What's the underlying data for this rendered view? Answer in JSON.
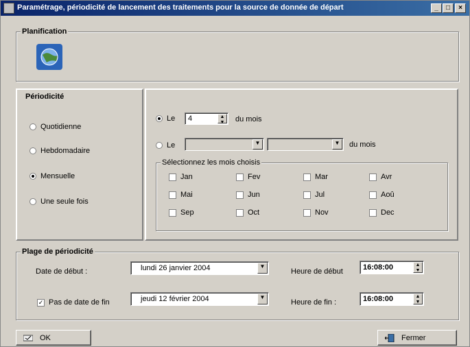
{
  "window": {
    "title": "Paramétrage, périodicité de lancement des traitements pour la source de donnée de départ",
    "minimize_label": "_",
    "maximize_label": "□",
    "close_label": "×"
  },
  "planification": {
    "legend": "Planification"
  },
  "periodicite": {
    "legend": "Périodicité",
    "options": [
      {
        "label": "Quotidienne",
        "checked": false
      },
      {
        "label": "Hebdomadaire",
        "checked": false
      },
      {
        "label": "Mensuelle",
        "checked": true
      },
      {
        "label": "Une seule fois",
        "checked": false
      }
    ]
  },
  "mensuel": {
    "le_label": "Le",
    "day_value": "4",
    "du_mois_label": "du mois",
    "le2_label": "Le",
    "du_mois2_label": "du mois",
    "months_legend": "Sélectionnez les mois choisis",
    "months": [
      "Jan",
      "Fev",
      "Mar",
      "Avr",
      "Mai",
      "Jun",
      "Jul",
      "Aoû",
      "Sep",
      "Oct",
      "Nov",
      "Dec"
    ]
  },
  "plage": {
    "legend": "Plage de périodicité",
    "date_debut_label": "Date de début :",
    "date_debut_value": "lundi   26   janvier   2004",
    "pas_date_fin_label": "Pas de date de fin",
    "pas_date_fin_checked": true,
    "date_fin_value": "jeudi   12   février   2004",
    "heure_debut_label": "Heure de début",
    "heure_debut_value": "16:08:00",
    "heure_fin_label": "Heure de fin :",
    "heure_fin_value": "16:08:00"
  },
  "buttons": {
    "ok_label": "OK",
    "fermer_label": "Fermer"
  },
  "icons": {
    "title": "window-app-icon",
    "planification": "globe-icon",
    "ok": "ok-icon",
    "fermer": "door-exit-icon"
  }
}
